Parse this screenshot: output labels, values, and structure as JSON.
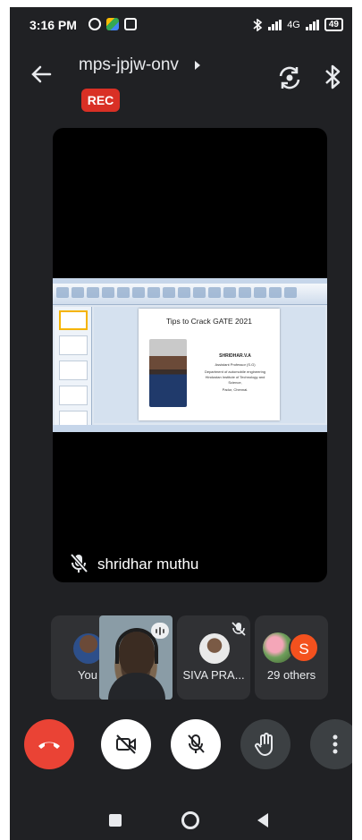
{
  "status_bar": {
    "time": "3:16 PM",
    "network_label": "4G",
    "battery": "49"
  },
  "meeting": {
    "code": "mps-jpjw-onv",
    "rec_badge": "REC"
  },
  "main_tile": {
    "presenter_name": "shridhar muthu",
    "slide": {
      "title": "Tips to Crack GATE 2021",
      "name": "SHRIDHAR.V.A",
      "lines": [
        "Assistant Professor (S.G)",
        "Department of automobile engineering",
        "Hindustan Institute of Technology and",
        "Science,",
        "Padur, Chennai."
      ]
    }
  },
  "participants": [
    {
      "label": "You",
      "muted": true
    },
    {
      "label": "",
      "speaking": true
    },
    {
      "label": "SIVA PRA...",
      "muted": true
    },
    {
      "label": "29 others",
      "avatar_letter": "S"
    }
  ],
  "controls": {
    "hangup_icon": "phone-hangup-icon",
    "camera_icon": "videocam-off-icon",
    "mic_icon": "mic-off-icon",
    "hand_icon": "raise-hand-icon",
    "more_icon": "more-vert-icon"
  },
  "colors": {
    "background": "#202124",
    "tile": "#303134",
    "rec_red": "#d93025",
    "hangup_red": "#ea4335",
    "avatar_orange": "#f4511e"
  }
}
